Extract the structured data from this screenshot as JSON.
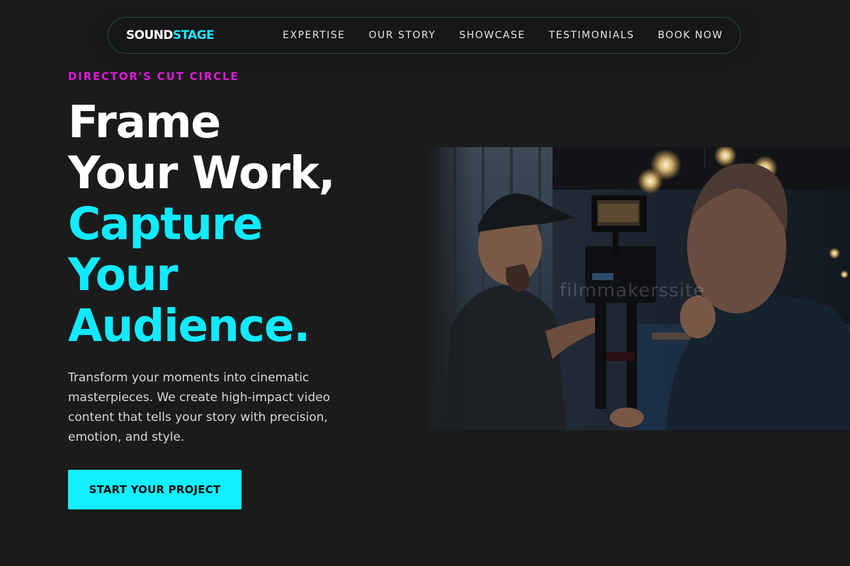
{
  "brand": {
    "logo_part1": "SOUND",
    "logo_part2": "STAGE",
    "accent_color": "#12eaff",
    "eyebrow_color": "#e01adc"
  },
  "nav": {
    "items": [
      {
        "label": "EXPERTISE"
      },
      {
        "label": "OUR STORY"
      },
      {
        "label": "SHOWCASE"
      },
      {
        "label": "TESTIMONIALS"
      },
      {
        "label": "BOOK NOW"
      }
    ]
  },
  "hero": {
    "eyebrow": "DIRECTOR'S CUT CIRCLE",
    "headline_white_1": "Frame",
    "headline_white_2": "Your Work,",
    "headline_cyan_1": "Capture",
    "headline_cyan_2": "Your",
    "headline_cyan_3": "Audience.",
    "description": "Transform your moments into cinematic masterpieces. We create high-impact video content that tells your story with precision, emotion, and style.",
    "cta_label": "START YOUR PROJECT",
    "image_watermark": "filmmakerssite"
  }
}
